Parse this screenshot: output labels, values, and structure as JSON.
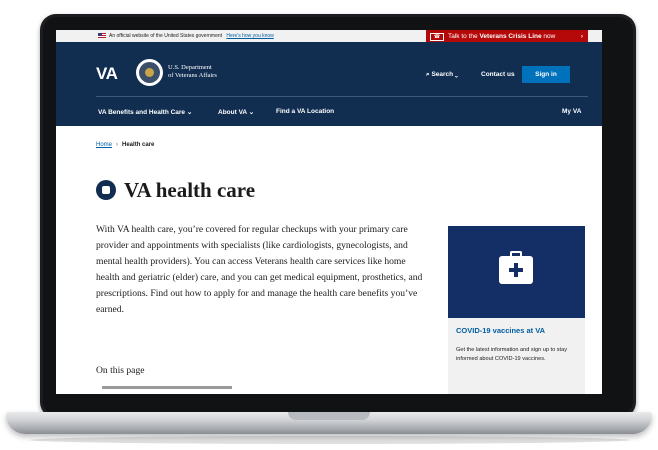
{
  "gov_banner": {
    "text": "An official website of the United States government",
    "link": "Here's how you know"
  },
  "crisis_line": {
    "prefix": "Talk to the",
    "bold": "Veterans Crisis Line",
    "suffix": "now",
    "arrow": "›",
    "color": "#b50909"
  },
  "header": {
    "logo": "VA",
    "dept_line1": "U.S. Department",
    "dept_line2": "of Veterans Affairs",
    "search": "⌕ Search ⌄",
    "contact": "Contact us",
    "signin": "Sign in",
    "background": "#112e51"
  },
  "nav": {
    "benefits": "VA Benefits and Health Care ⌄",
    "about": "About VA ⌄",
    "find": "Find a VA Location",
    "myva": "My VA"
  },
  "breadcrumb": {
    "home": "Home",
    "separator": "›",
    "current": "Health care"
  },
  "page": {
    "title": "VA health care",
    "title_icon": "home-health-icon",
    "intro": "With VA health care, you’re covered for regular checkups with your primary care provider and appointments with specialists (like cardiologists, gynecologists, and mental health providers). You can access Veterans health care services like home health and geriatric (elder) care, and you can get medical equipment, prosthetics, and prescriptions. Find out how to apply for and manage the health care benefits you’ve earned.",
    "on_this_page": "On this page"
  },
  "promo": {
    "icon": "first-aid-kit-icon",
    "title": "COVID-19 vaccines at VA",
    "text": "Get the latest information and sign up to stay informed about COVID-19 vaccines.",
    "image_color": "#142e66"
  }
}
